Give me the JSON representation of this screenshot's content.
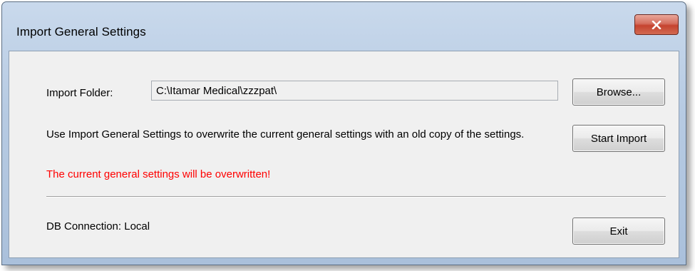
{
  "window": {
    "title": "Import General Settings",
    "close_icon": "close-x-icon"
  },
  "import_folder": {
    "label": "Import Folder:",
    "value": "C:\\Itamar Medical\\zzzpat\\"
  },
  "buttons": {
    "browse": "Browse...",
    "start_import": "Start Import",
    "exit": "Exit"
  },
  "description": "Use Import General Settings to overwrite the current general settings with an old copy of the settings.",
  "warning": "The current general settings will be overwritten!",
  "db_connection": "DB Connection: Local",
  "colors": {
    "warning": "#ff0000",
    "close_button": "#c5432f",
    "title_bar": "#b7cbe3"
  }
}
